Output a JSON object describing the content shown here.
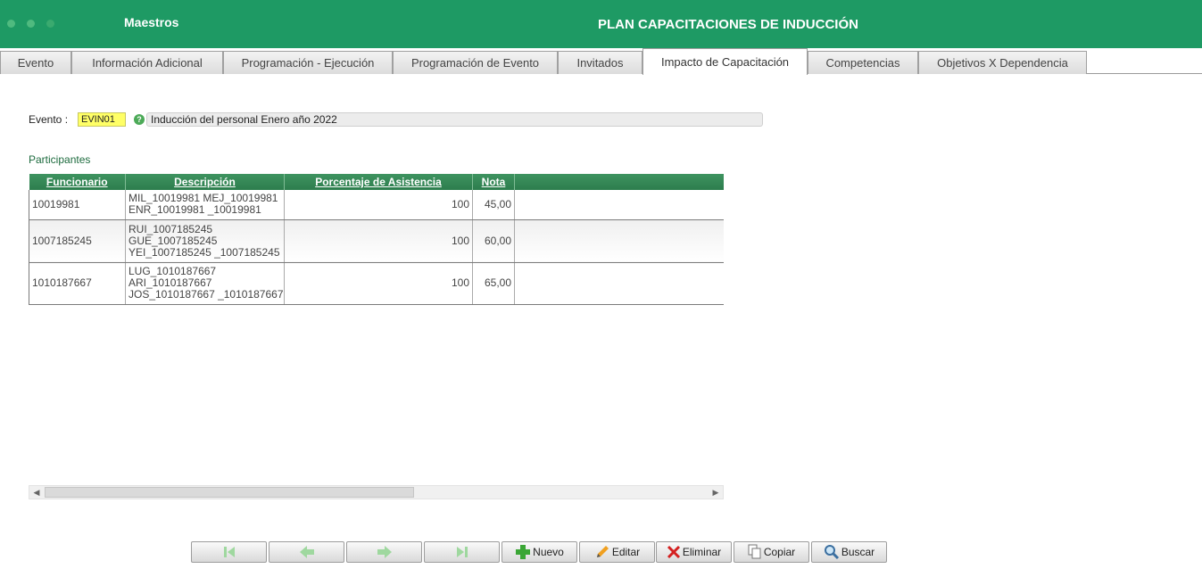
{
  "header": {
    "module_title": "Maestros",
    "page_title": "PLAN CAPACITACIONES DE INDUCCIÓN",
    "accent_color": "#1e9a64"
  },
  "tabs": [
    {
      "label": "Evento"
    },
    {
      "label": "Información Adicional"
    },
    {
      "label": "Programación - Ejecución"
    },
    {
      "label": "Programación de Evento"
    },
    {
      "label": "Invitados"
    },
    {
      "label": "Impacto de Capacitación",
      "active": true
    },
    {
      "label": "Competencias"
    },
    {
      "label": "Objetivos X Dependencia"
    }
  ],
  "evento": {
    "label": "Evento :",
    "code": "EVIN01",
    "help_icon": "help-icon",
    "description": "Inducción del personal Enero año 2022"
  },
  "participantes": {
    "section_label": "Participantes",
    "columns": [
      "Funcionario",
      "Descripción",
      "Porcentaje de Asistencia",
      "Nota"
    ],
    "rows": [
      {
        "funcionario": "10019981",
        "descripcion": [
          "MIL_10019981 MEJ_10019981",
          "ENR_10019981 _10019981"
        ],
        "porcentaje": "100",
        "nota": "45,00"
      },
      {
        "funcionario": "1007185245",
        "descripcion": [
          "RUI_1007185245",
          "GUE_1007185245",
          "YEI_1007185245 _1007185245"
        ],
        "porcentaje": "100",
        "nota": "60,00"
      },
      {
        "funcionario": "1010187667",
        "descripcion": [
          "LUG_1010187667",
          "ARI_1010187667",
          "JOS_1010187667 _1010187667"
        ],
        "porcentaje": "100",
        "nota": "65,00"
      }
    ]
  },
  "toolbar": {
    "first_icon": "first-record-icon",
    "prev_icon": "previous-arrow-icon",
    "next_icon": "next-arrow-icon",
    "last_icon": "last-record-icon",
    "nuevo": "Nuevo",
    "editar": "Editar",
    "eliminar": "Eliminar",
    "copiar": "Copiar",
    "buscar": "Buscar"
  }
}
